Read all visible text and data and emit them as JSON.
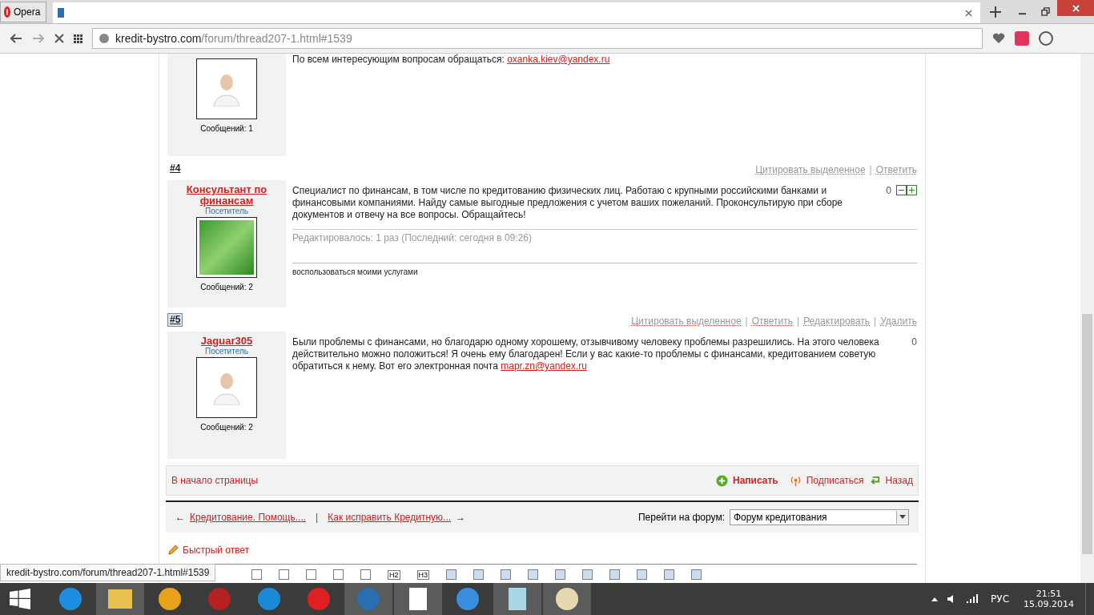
{
  "browser": {
    "menu_label": "Opera",
    "address_host": "kredit-bystro.com",
    "address_path": "/forum/thread207-1.html#1539"
  },
  "posts": [
    {
      "avatar": {
        "kind": "person"
      },
      "messages": "Сообщений: 1",
      "body_text": "По всем интересующим вопросам обращаться: ",
      "body_link": "oxanka.kiev@yandex.ru"
    },
    {
      "number": "#4",
      "focused": false,
      "action_separator": "|",
      "actions": [
        "Цитировать выделенное",
        "Ответить"
      ],
      "author": "Консультант по финансам",
      "role": "Посетитель",
      "avatar": {
        "kind": "money"
      },
      "messages": "Сообщений: 2",
      "body_text": "Специалист по финансам, в том числе по кредитованию физических лиц. Работаю с крупными российскими банками и финансовыми компаниями. Найду самые выгодные предложения с учетом ваших пожеланий. Проконсультирую при сборе документов и отвечу на все вопросы. Обращайтесь!",
      "edited": "Редактировалось: 1 раз (Последний: сегодня в 09:26)",
      "signature": "воспользоваться моими услугами",
      "votes": "0",
      "vote_buttons": true
    },
    {
      "number": "#5",
      "focused": true,
      "action_separator": "|",
      "actions": [
        "Цитировать выделенное",
        "Ответить",
        "Редактировать",
        "Удалить"
      ],
      "author": "Jaguar305",
      "role": "Посетитель",
      "avatar": {
        "kind": "person"
      },
      "messages": "Сообщений: 2",
      "body_text": "Были проблемы с финансами, но благодарю одному хорошему, отзывчивому человеку проблемы разрешились. На этого человека действительно можно положиться! Я очень ему благодарен! Если у вас какие-то проблемы с финансами, кредитованием советую обратиться к нему. Вот его электронная почта ",
      "body_link": "mapr.zn@yandex.ru",
      "votes": "0"
    }
  ],
  "footer_bar": {
    "top_link": "В начало страницы",
    "write": "Написать",
    "subscribe": "Подписаться",
    "back": "Назад"
  },
  "thread_nav": {
    "prev_arrow": "←",
    "prev": "Кредитование. Помощь....",
    "separator": "|",
    "next": "Как исправить Кредитную...",
    "next_arrow": "→",
    "jump_label": "Перейти на форум:",
    "jump_value": "Форум кредитования"
  },
  "quick_reply": "Быстрый ответ",
  "editor_toolbar": [
    "H2",
    "H3"
  ],
  "status_url": "kredit-bystro.com/forum/thread207-1.html#1539",
  "taskbar": {
    "language": "РУС",
    "time": "21:51",
    "date": "15.09.2014"
  }
}
